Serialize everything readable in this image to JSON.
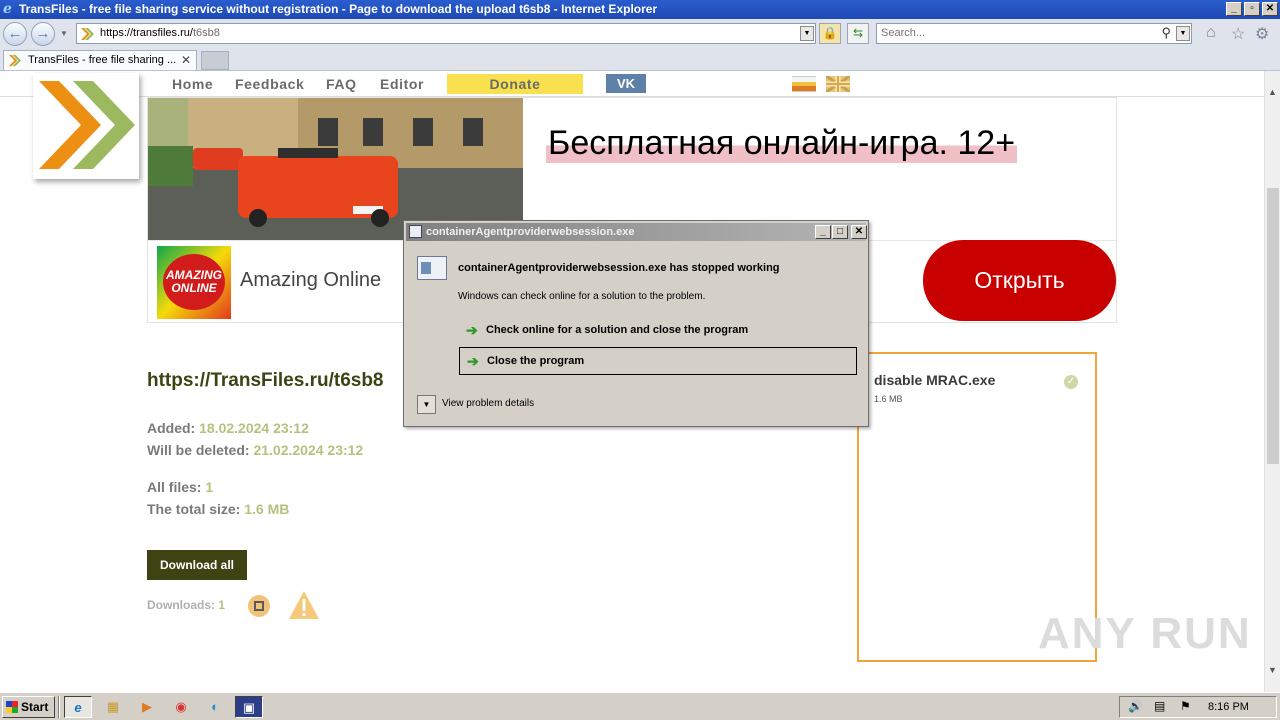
{
  "window": {
    "title": "TransFiles - free file sharing service without registration - Page to download the upload t6sb8 - Internet Explorer",
    "buttons": [
      "_",
      "▫",
      "✕"
    ]
  },
  "browser": {
    "url_host": "https://transfiles.ru/",
    "url_path": "t6sb8",
    "search_placeholder": "Search...",
    "tab_title": "TransFiles - free file sharing ..."
  },
  "site_nav": {
    "items": [
      "Home",
      "Feedback",
      "FAQ",
      "Editor"
    ],
    "donate": "Donate",
    "vk": "VK"
  },
  "ad": {
    "headline": "Бесплатная онлайн-игра. 12+",
    "brand_logo_text": "AMAZING ONLINE",
    "brand": "Amazing Online",
    "button": "Открыть"
  },
  "file": {
    "url": "https://TransFiles.ru/t6sb8",
    "added_label": "Added:",
    "added_value": "18.02.2024 23:12",
    "deleted_label": "Will be deleted:",
    "deleted_value": "21.02.2024 23:12",
    "all_files_label": "All files:",
    "all_files_value": "1",
    "total_size_label": "The total size:",
    "total_size_value": "1.6 MB",
    "download_all": "Download all",
    "downloads_label": "Downloads:",
    "downloads_value": "1",
    "item_name": "disable MRAC.exe",
    "item_size": "1.6 MB"
  },
  "watermark": "ANY RUN",
  "dialog": {
    "title": "containerAgentproviderwebsession.exe",
    "heading": "containerAgentproviderwebsession.exe has stopped working",
    "subtext": "Windows can check online for a solution to the problem.",
    "option_check": "Check online for a solution and close the program",
    "option_close": "Close the program",
    "details": "View problem details"
  },
  "taskbar": {
    "start": "Start",
    "clock": "8:16 PM"
  },
  "colors": {
    "accent_olive": "#3e4313",
    "date_green": "#b7c17f",
    "donate_yellow": "#f8e04e",
    "ad_red": "#c80000",
    "file_border": "#f0a43a"
  }
}
